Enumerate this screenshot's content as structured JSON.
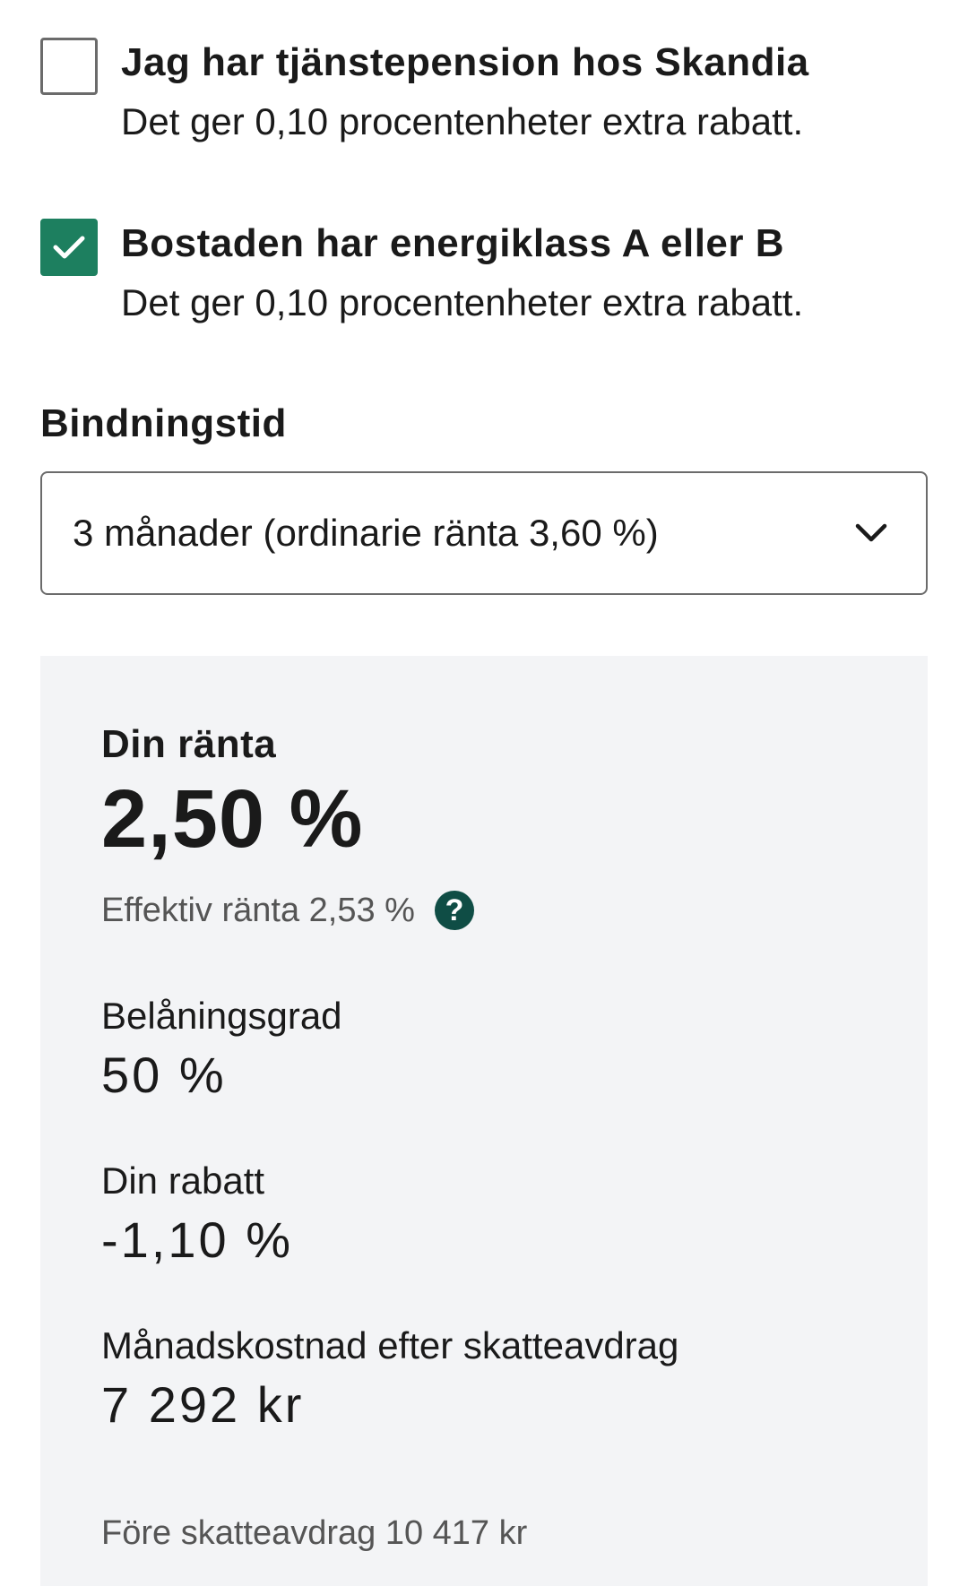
{
  "checkboxes": [
    {
      "title": "Jag har tjänstepension hos Skandia",
      "description": "Det ger 0,10 procentenheter extra rabatt.",
      "checked": false
    },
    {
      "title": "Bostaden har energiklass A eller B",
      "description": "Det ger 0,10 procentenheter extra rabatt.",
      "checked": true
    }
  ],
  "binding": {
    "label": "Bindningstid",
    "selected": "3 månader (ordinarie ränta 3,60 %)"
  },
  "summary": {
    "rate_label": "Din ränta",
    "rate_value": "2,50 %",
    "effective_rate": "Effektiv ränta 2,53 %",
    "help_icon": "question-circle-icon",
    "ltv_label": "Belåningsgrad",
    "ltv_value": "50 %",
    "discount_label": "Din rabatt",
    "discount_value": "-1,10 %",
    "monthly_label": "Månadskostnad efter skatteavdrag",
    "monthly_value": "7 292 kr",
    "pre_tax": "Före skatteavdrag 10 417 kr"
  },
  "colors": {
    "accent_green": "#1d7f5f",
    "help_icon_bg": "#0f4d45",
    "panel_bg": "#f3f4f6"
  }
}
